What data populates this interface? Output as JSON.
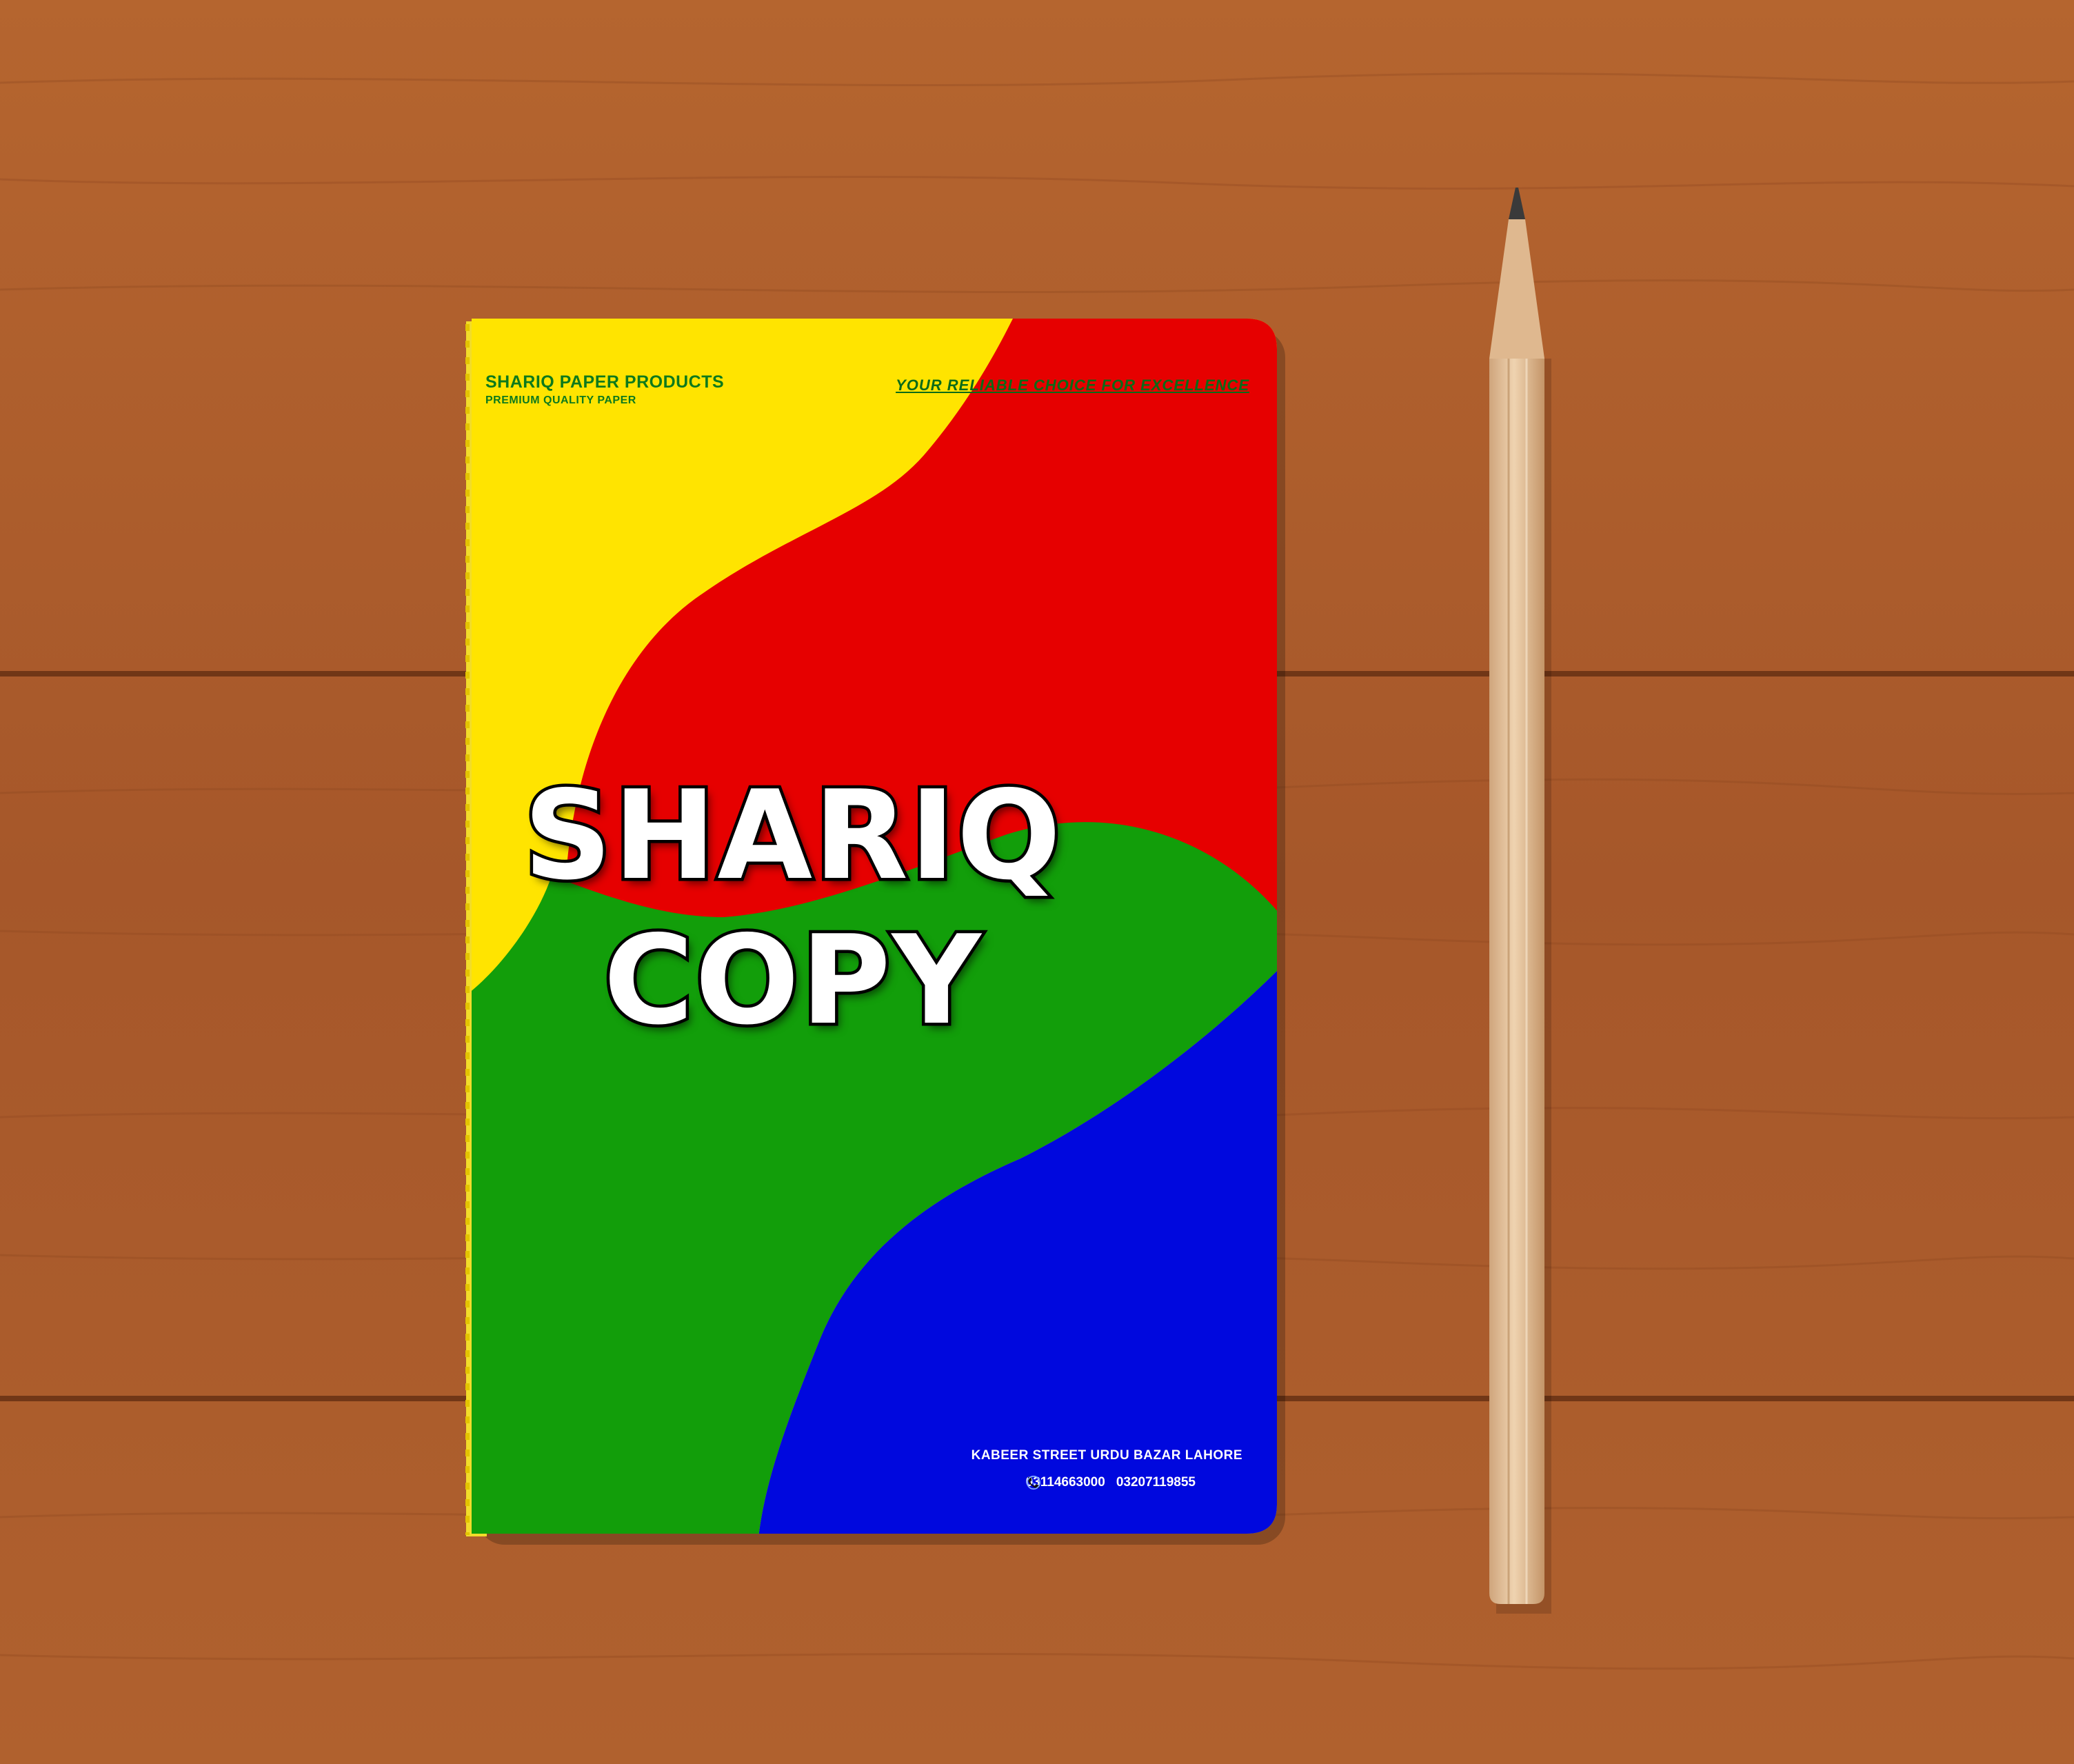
{
  "cover": {
    "brand": "SHARIQ PAPER PRODUCTS",
    "subbrand": "PREMIUM QUALITY PAPER",
    "tagline": "YOUR RELIABLE CHOICE FOR EXCELLENCE",
    "title_line1": "SHARIQ",
    "title_line2": "COPY",
    "address": "KABEER STREET URDU BAZAR LAHORE",
    "phone": "03114663000",
    "whatsapp": "03207119855",
    "phone_icon": "phone-icon",
    "whatsapp_icon": "whatsapp-icon"
  },
  "colors": {
    "wood": "#a85a2c",
    "yellow": "#ffe400",
    "red": "#e60000",
    "green": "#129e0a",
    "blue": "#0008de",
    "brand_text": "#0d7a1c"
  }
}
